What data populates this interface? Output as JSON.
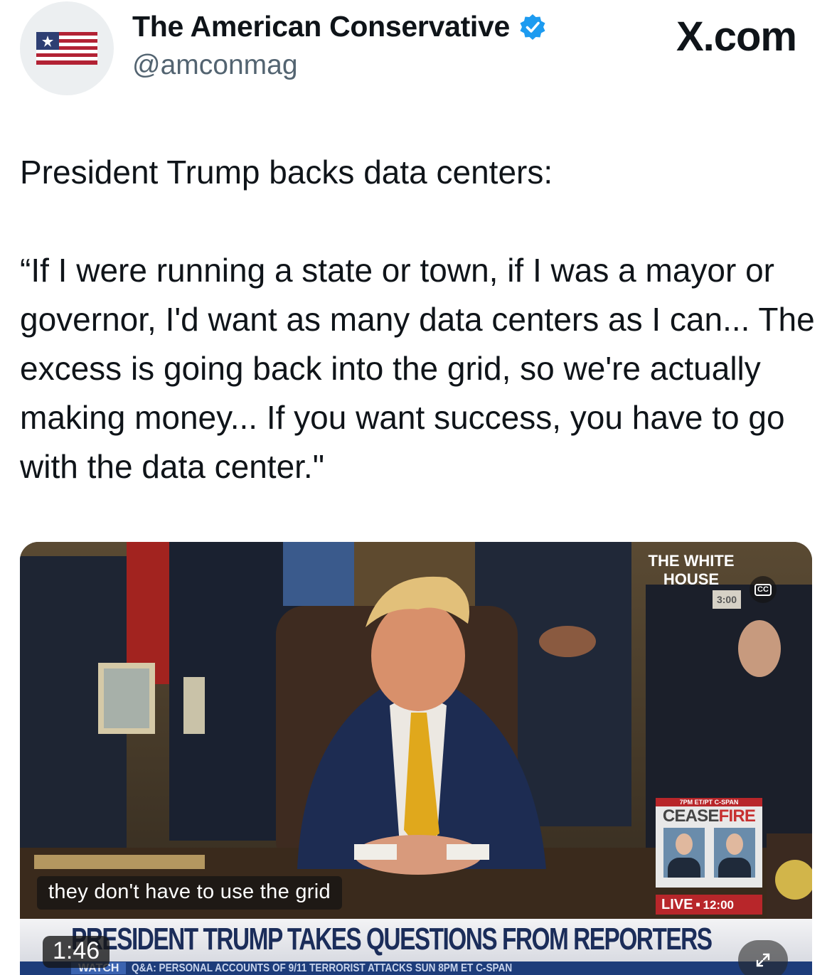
{
  "header": {
    "display_name": "The American Conservative",
    "handle": "@amconmag",
    "source": "X.com",
    "verified": true,
    "verified_color": "#1d9bf0",
    "avatar_icon": "american-flag-icon"
  },
  "tweet": {
    "lead": "President Trump backs data centers:",
    "quote": "“If I were running a state or town, if I was a mayor or governor, I'd want as many data centers as I can... The excess is going back into the grid, so we're actually making money... If you want success, you have to go with the data center.\""
  },
  "video": {
    "network_bug": "THE WHITE HOUSE",
    "network_time": "3:00",
    "cc_label": "CC",
    "promo_top": "7PM ET/PT C-SPAN",
    "promo_title_a": "CEASE",
    "promo_title_b": "FIRE",
    "live_label": "LIVE",
    "live_time": "12:00",
    "caption": "they don't have to use the grid",
    "lower_third": "PRESIDENT TRUMP TAKES QUESTIONS FROM REPORTERS",
    "ticker_tag": "WATCH",
    "ticker_text": "Q&A: PERSONAL ACCOUNTS OF 9/11 TERRORIST ATTACKS  SUN 8PM ET C-SPAN",
    "duration": "1:46",
    "tie_color": "#e0a81c",
    "suit_color": "#1d2c52"
  }
}
